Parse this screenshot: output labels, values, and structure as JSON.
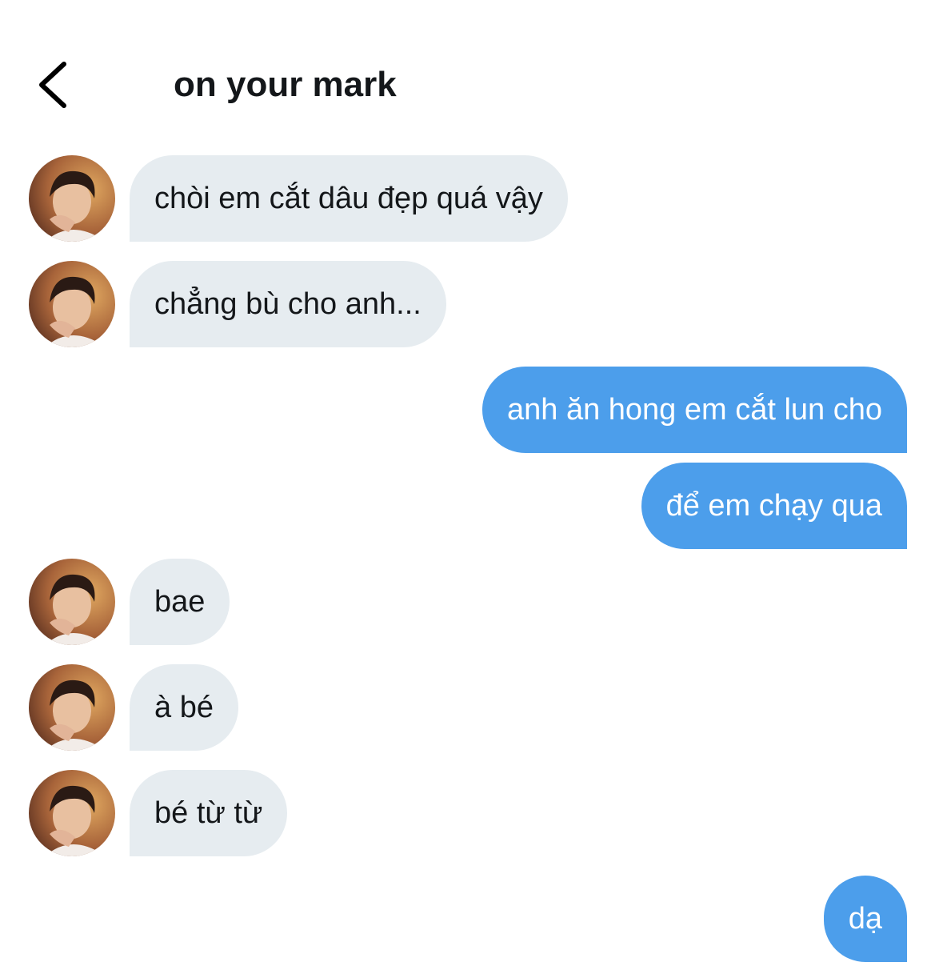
{
  "header": {
    "back_icon": "chevron-left-icon",
    "title": "on your mark"
  },
  "colors": {
    "incoming_bubble": "#e6ecf0",
    "outgoing_bubble": "#4c9eeb",
    "text_dark": "#14171a",
    "text_light": "#ffffff"
  },
  "messages": [
    {
      "direction": "incoming",
      "text": "chòi em cắt dâu đẹp quá vậy"
    },
    {
      "direction": "incoming",
      "text": "chẳng bù cho anh..."
    },
    {
      "direction": "outgoing",
      "text": "anh ăn hong em cắt lun cho"
    },
    {
      "direction": "outgoing",
      "text": "để em chạy qua"
    },
    {
      "direction": "incoming",
      "text": "bae"
    },
    {
      "direction": "incoming",
      "text": "à bé"
    },
    {
      "direction": "incoming",
      "text": "bé từ từ"
    },
    {
      "direction": "outgoing",
      "text": "dạ"
    }
  ]
}
